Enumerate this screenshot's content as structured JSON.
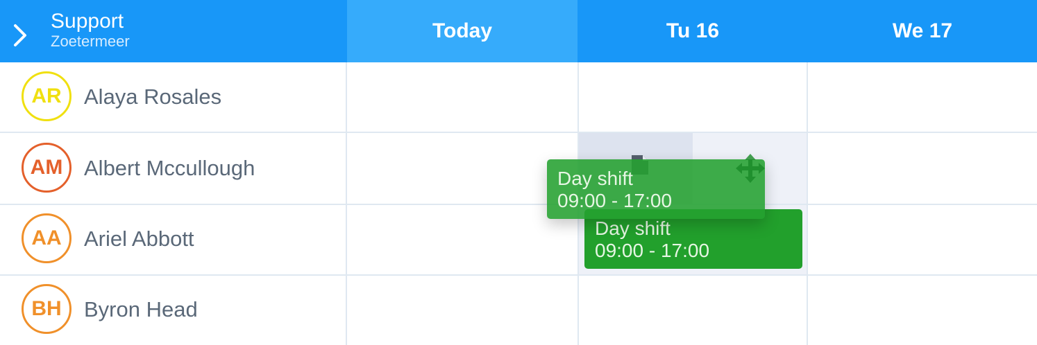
{
  "team": {
    "name": "Support",
    "location": "Zoetermeer"
  },
  "days": [
    "Today",
    "Tu 16",
    "We 17"
  ],
  "employees": [
    {
      "initials": "AR",
      "name": "Alaya Rosales",
      "color": "#f0e010"
    },
    {
      "initials": "AM",
      "name": "Albert Mccullough",
      "color": "#e4602b"
    },
    {
      "initials": "AA",
      "name": "Ariel Abbott",
      "color": "#f0902a"
    },
    {
      "initials": "BH",
      "name": "Byron Head",
      "color": "#f0902a"
    }
  ],
  "shifts": {
    "placed": {
      "title": "Day shift",
      "time": "09:00 - 17:00"
    },
    "dragging": {
      "title": "Day shift",
      "time": "09:00 - 17:00"
    }
  },
  "colors": {
    "header": "#1897f8",
    "today_header": "#36abfb",
    "shift": "#22a02c"
  },
  "icons": {
    "expand": "chevron-right-icon",
    "copy": "document-icon",
    "move": "move-icon"
  }
}
